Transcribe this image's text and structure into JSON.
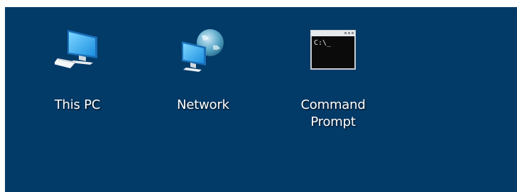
{
  "desktop": {
    "background_color": "#023a68",
    "icons": [
      {
        "label": "This PC",
        "icon": "computer-icon"
      },
      {
        "label": "Network",
        "icon": "network-icon"
      },
      {
        "label": "Command Prompt",
        "icon": "command-prompt-icon",
        "icon_text": "C:\\_"
      }
    ]
  }
}
